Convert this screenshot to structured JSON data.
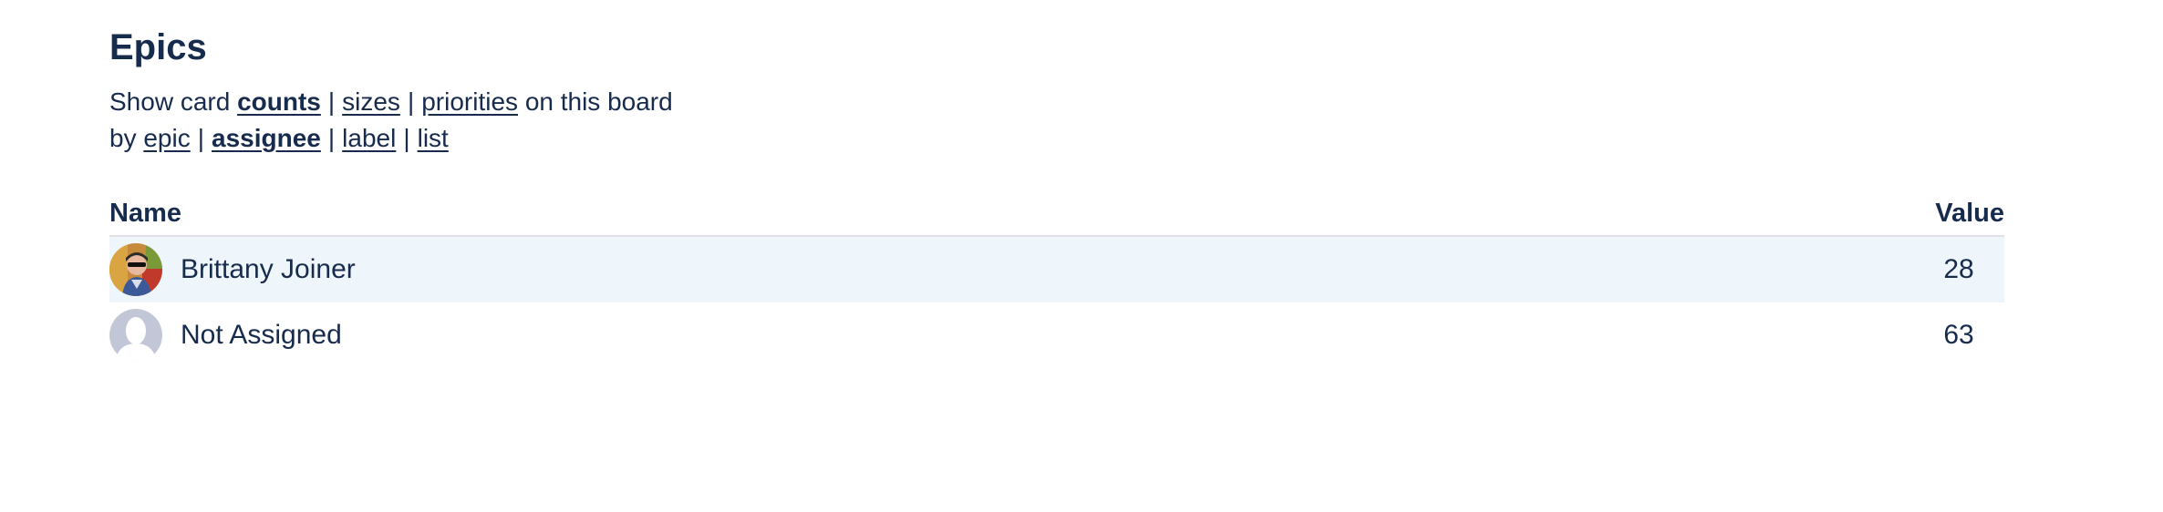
{
  "page_title": "Epics",
  "show": {
    "prefix": "Show card",
    "options": [
      "counts",
      "sizes",
      "priorities"
    ],
    "suffix": "on this board",
    "active": "counts"
  },
  "group_by": {
    "prefix": "by",
    "options": [
      "epic",
      "assignee",
      "label",
      "list"
    ],
    "active": "assignee"
  },
  "table": {
    "headers": {
      "name": "Name",
      "value": "Value"
    },
    "rows": [
      {
        "name": "Brittany Joiner",
        "value": "28",
        "avatar": "user-photo"
      },
      {
        "name": "Not Assigned",
        "value": "63",
        "avatar": "default-avatar-icon"
      }
    ]
  },
  "colors": {
    "text": "#172b4d",
    "row_highlight": "#eef6fb",
    "default_avatar": "#c1c7d6"
  }
}
